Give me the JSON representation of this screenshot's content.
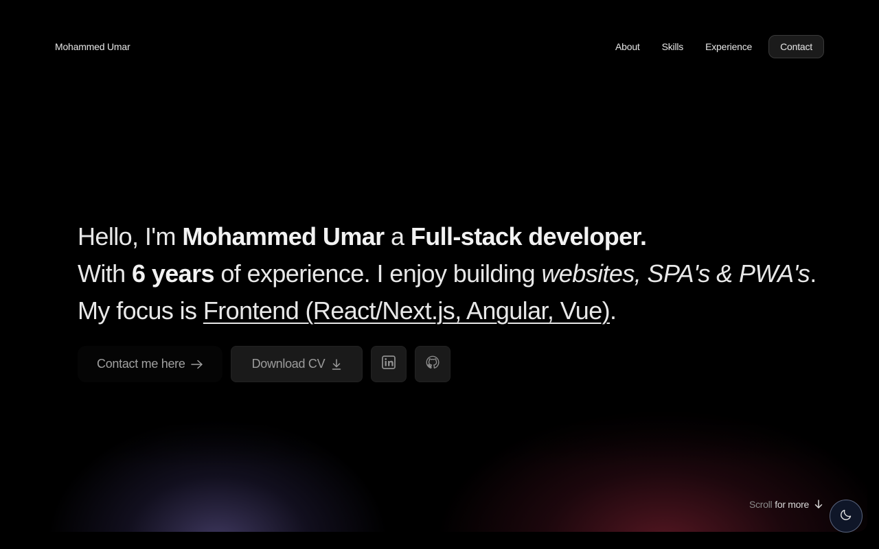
{
  "header": {
    "brand": "Mohammed Umar",
    "nav": [
      "About",
      "Skills",
      "Experience",
      "Contact"
    ]
  },
  "hero": {
    "line1": {
      "t1": "Hello, I'm ",
      "name": "Mohammed Umar",
      "t2": " a ",
      "role": "Full-stack developer."
    },
    "line2": {
      "t1": "With ",
      "years": "6 years",
      "t2": " of experience. I enjoy building ",
      "things": "websites, SPA's & PWA's",
      "t3": "."
    },
    "line3": {
      "t1": "My focus is ",
      "focus": "Frontend (React/Next.js, Angular, Vue)",
      "t2": "."
    }
  },
  "actions": {
    "contact_label": "Contact me here",
    "cv_label": "Download CV",
    "icons": [
      "arrow-right-icon",
      "download-icon",
      "linkedin-icon",
      "github-icon"
    ]
  },
  "scroll_hint": {
    "muted": "Scroll",
    "strong": "for more"
  },
  "theme": {
    "icon": "moon-icon"
  }
}
